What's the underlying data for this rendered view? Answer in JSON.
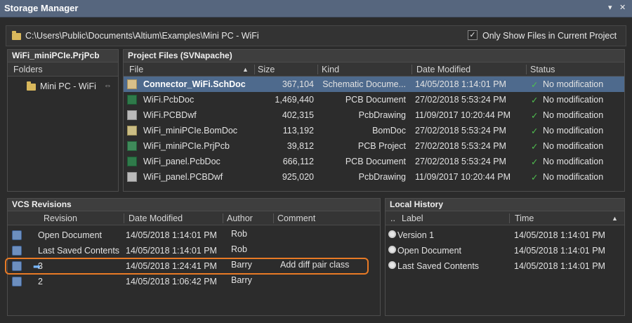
{
  "window": {
    "title": "Storage Manager",
    "pin_glyph": "▾",
    "close_glyph": "✕"
  },
  "pathbar": {
    "path": "C:\\Users\\Public\\Documents\\Altium\\Examples\\Mini PC - WiFi",
    "checkbox_label": "Only Show Files in Current Project",
    "checkbox_checked": true,
    "check_glyph": "✓"
  },
  "folders_panel": {
    "title": "WiFi_miniPCIe.PrjPcb",
    "header": "Folders",
    "item": "Mini PC - WiFi",
    "link_glyph": "⇔"
  },
  "files_panel": {
    "title": "Project Files (SVNapache)",
    "columns": {
      "file": "File",
      "size": "Size",
      "kind": "Kind",
      "date": "Date Modified",
      "status": "Status"
    },
    "sort_glyph": "▲",
    "check_glyph": "✓",
    "rows": [
      {
        "icon": "schematic-file-icon",
        "name": "Connector_WiFi.SchDoc",
        "size": "367,104",
        "kind": "Schematic Docume...",
        "date": "14/05/2018 1:14:01 PM",
        "status": "No modification"
      },
      {
        "icon": "pcb-file-icon",
        "name": "WiFi.PcbDoc",
        "size": "1,469,440",
        "kind": "PCB Document",
        "date": "27/02/2018 5:53:24 PM",
        "status": "No modification"
      },
      {
        "icon": "pcb-drawing-file-icon",
        "name": "WiFi.PCBDwf",
        "size": "402,315",
        "kind": "PcbDrawing",
        "date": "11/09/2017 10:20:44 PM",
        "status": "No modification"
      },
      {
        "icon": "bom-file-icon",
        "name": "WiFi_miniPCIe.BomDoc",
        "size": "113,192",
        "kind": "BomDoc",
        "date": "27/02/2018 5:53:24 PM",
        "status": "No modification"
      },
      {
        "icon": "pcb-project-file-icon",
        "name": "WiFi_miniPCIe.PrjPcb",
        "size": "39,812",
        "kind": "PCB Project",
        "date": "27/02/2018 5:53:24 PM",
        "status": "No modification"
      },
      {
        "icon": "pcb-file-icon",
        "name": "WiFi_panel.PcbDoc",
        "size": "666,112",
        "kind": "PCB Document",
        "date": "27/02/2018 5:53:24 PM",
        "status": "No modification"
      },
      {
        "icon": "pcb-drawing-file-icon",
        "name": "WiFi_panel.PCBDwf",
        "size": "925,020",
        "kind": "PcbDrawing",
        "date": "11/09/2017 10:20:44 PM",
        "status": "No modification"
      }
    ]
  },
  "vcs_panel": {
    "title": "VCS Revisions",
    "columns": {
      "revision": "Revision",
      "date": "Date Modified",
      "author": "Author",
      "comment": "Comment"
    },
    "current_glyph": "➡",
    "rows": [
      {
        "revision": "Open Document",
        "date": "14/05/2018 1:14:01 PM",
        "author": "Rob",
        "comment": ""
      },
      {
        "revision": "Last Saved Contents",
        "date": "14/05/2018 1:14:01 PM",
        "author": "Rob",
        "comment": ""
      },
      {
        "revision": "3",
        "date": "14/05/2018 1:24:41 PM",
        "author": "Barry",
        "comment": "Add diff pair class"
      },
      {
        "revision": "2",
        "date": "14/05/2018 1:06:42 PM",
        "author": "Barry",
        "comment": ""
      }
    ]
  },
  "history_panel": {
    "title": "Local History",
    "columns": {
      "dots": "..",
      "label": "Label",
      "time": "Time"
    },
    "sort_glyph": "▲",
    "rows": [
      {
        "label": "Version 1",
        "time": "14/05/2018 1:14:01 PM"
      },
      {
        "label": "Open Document",
        "time": "14/05/2018 1:14:01 PM"
      },
      {
        "label": "Last Saved Contents",
        "time": "14/05/2018 1:14:01 PM"
      }
    ]
  },
  "colors": {
    "accent_selection": "#4e6a8d",
    "highlight_outline": "#e87a25",
    "status_ok": "#4fbf4f"
  }
}
